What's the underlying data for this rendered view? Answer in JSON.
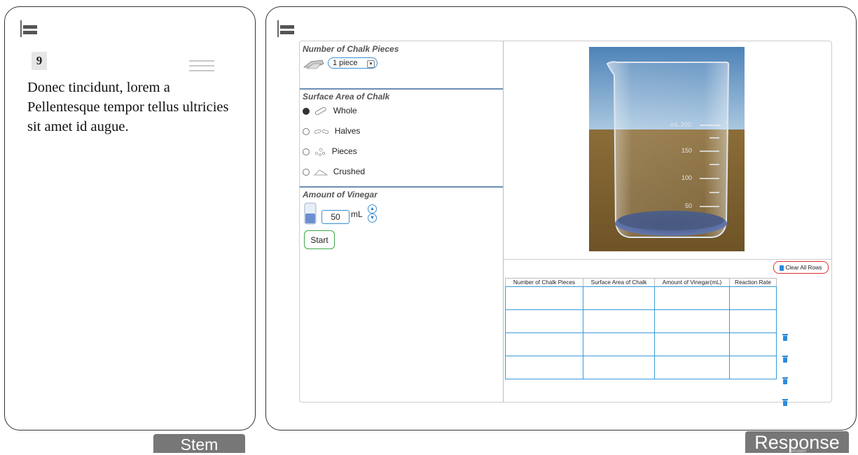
{
  "stem": {
    "question_number": "9",
    "text": "Donec tincidunt, lorem a Pellentesque tempor tellus ultricies sit amet id augue.",
    "tab_label": "Stem"
  },
  "response": {
    "tab_label": "Response",
    "tab_sublabel": "Simulator"
  },
  "simulator": {
    "chalk_pieces": {
      "title": "Number of Chalk Pieces",
      "selected": "1 piece"
    },
    "surface_area": {
      "title": "Surface Area of Chalk",
      "options": [
        {
          "label": "Whole",
          "checked": true
        },
        {
          "label": "Halves",
          "checked": false
        },
        {
          "label": "Pieces",
          "checked": false
        },
        {
          "label": "Crushed",
          "checked": false
        }
      ]
    },
    "vinegar": {
      "title": "Amount of Vinegar",
      "value": "50",
      "unit": "mL"
    },
    "start_label": "Start",
    "beaker": {
      "mark_200": "mL 200",
      "mark_150": "150",
      "mark_100": "100",
      "mark_50": "50"
    },
    "table": {
      "clear_label": "Clear All Rows",
      "headers": [
        "Number of Chalk Pieces",
        "Surface Area of Chalk",
        "Amount of Vinegar(mL)",
        "Reaction Rate"
      ],
      "row_count": 4
    }
  },
  "colors": {
    "accent_blue": "#3a8fd6",
    "start_green": "#3aa648",
    "clear_red": "#e03030",
    "tab_gray": "#777777"
  }
}
